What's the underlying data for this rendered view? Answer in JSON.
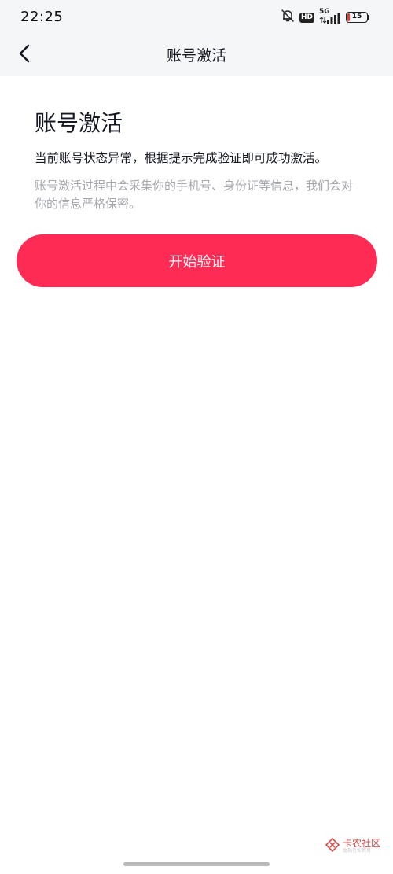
{
  "status_bar": {
    "time": "22:25",
    "network": "5G",
    "hd": "HD",
    "battery_level": "15",
    "battery_fraction": 0.15,
    "icons": [
      "bell-muted-icon",
      "hd-icon",
      "signal-5g-icon",
      "battery-icon"
    ]
  },
  "nav": {
    "back_icon": "chevron-left-icon",
    "title": "账号激活"
  },
  "content": {
    "heading": "账号激活",
    "description": "当前账号状态异常，根据提示完成验证即可成功激活。",
    "sub_description": "账号激活过程中会采集你的手机号、身份证等信息，我们会对你的信息严格保密。"
  },
  "action": {
    "start_label": "开始验证"
  },
  "colors": {
    "accent": "#fe2c55",
    "text_primary": "#161823",
    "text_secondary": "#a5a7ad",
    "header_bg": "#f5f6f7"
  },
  "watermark": {
    "title": "卡农社区",
    "subtitle": "金融行业教育"
  }
}
